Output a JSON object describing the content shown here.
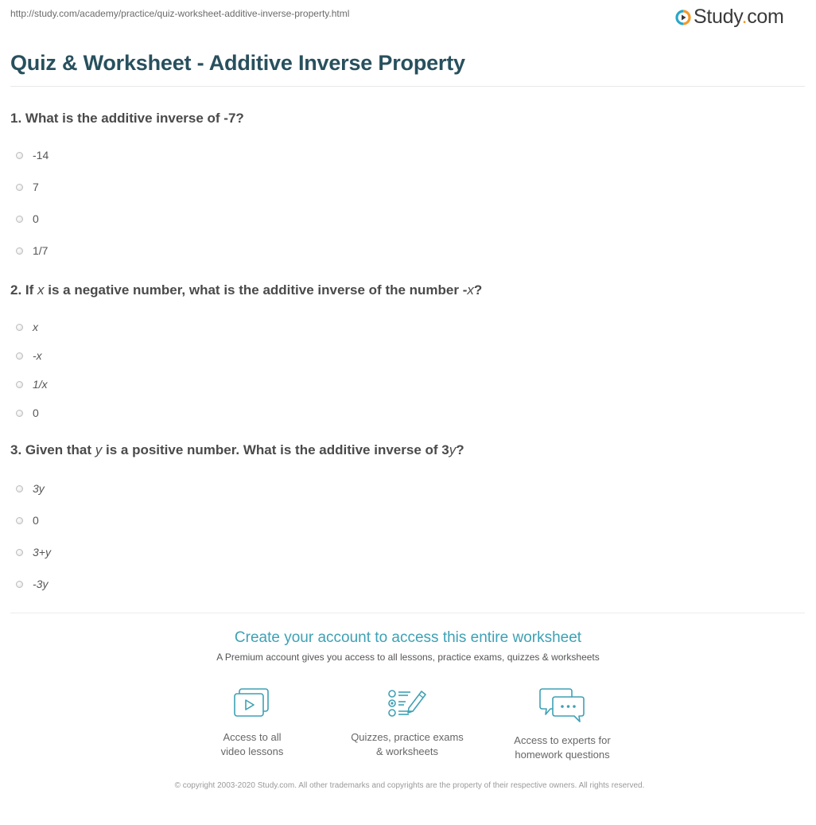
{
  "url": "http://study.com/academy/practice/quiz-worksheet-additive-inverse-property.html",
  "logo": {
    "name": "Study",
    "dot": ".",
    "tld": "com",
    "accent": "#f39a2b",
    "brand_blue": "#2aa7c9"
  },
  "title": "Quiz & Worksheet - Additive Inverse Property",
  "questions": [
    {
      "number": "1.",
      "parts": [
        {
          "t": " What is the additive inverse of -7?",
          "i": false
        }
      ],
      "options": [
        "-14",
        "7",
        "0",
        "1/7"
      ],
      "options_italic": [
        false,
        false,
        false,
        false
      ]
    },
    {
      "number": "2.",
      "parts": [
        {
          "t": " If ",
          "i": false
        },
        {
          "t": "x",
          "i": true
        },
        {
          "t": " is a negative number, what is the additive inverse of the number -",
          "i": false
        },
        {
          "t": "x",
          "i": true
        },
        {
          "t": "?",
          "i": false
        }
      ],
      "options": [
        "x",
        "-x",
        "1/x",
        "0"
      ],
      "options_italic": [
        true,
        true,
        true,
        false
      ]
    },
    {
      "number": "3.",
      "parts": [
        {
          "t": " Given that ",
          "i": false
        },
        {
          "t": "y",
          "i": true
        },
        {
          "t": " is a positive number. What is the additive inverse of 3",
          "i": false
        },
        {
          "t": "y",
          "i": true
        },
        {
          "t": "?",
          "i": false
        }
      ],
      "options": [
        "3y",
        "0",
        "3+y",
        "-3y"
      ],
      "options_italic": [
        true,
        false,
        true,
        true
      ]
    }
  ],
  "cta": {
    "title": "Create your account to access this entire worksheet",
    "subtitle": "A Premium account gives you access to all lessons, practice exams, quizzes & worksheets",
    "accent": "#3ea1b4"
  },
  "features": [
    {
      "icon": "video-lessons-icon",
      "label": "Access to all\nvideo lessons"
    },
    {
      "icon": "quiz-checklist-icon",
      "label": "Quizzes, practice exams\n& worksheets"
    },
    {
      "icon": "chat-bubbles-icon",
      "label": "Access to experts for\nhomework questions"
    }
  ],
  "copyright": "© copyright 2003-2020 Study.com. All other trademarks and copyrights are the property of their respective owners. All rights reserved."
}
